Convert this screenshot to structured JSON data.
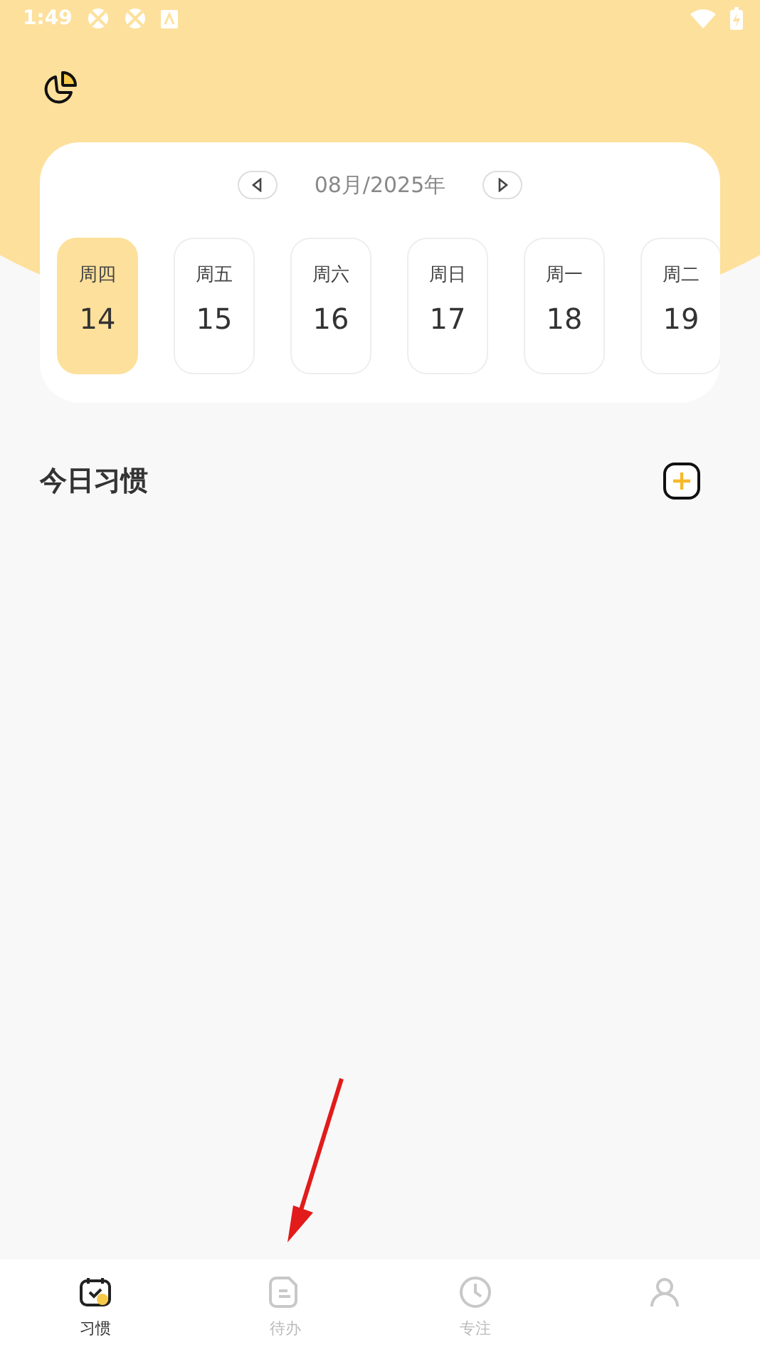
{
  "status_bar": {
    "time": "1:49"
  },
  "calendar": {
    "month": "08月/2025年",
    "days": [
      {
        "weekday": "周四",
        "date": "14",
        "selected": true
      },
      {
        "weekday": "周五",
        "date": "15",
        "selected": false
      },
      {
        "weekday": "周六",
        "date": "16",
        "selected": false
      },
      {
        "weekday": "周日",
        "date": "17",
        "selected": false
      },
      {
        "weekday": "周一",
        "date": "18",
        "selected": false
      },
      {
        "weekday": "周二",
        "date": "19",
        "selected": false
      }
    ]
  },
  "section": {
    "title": "今日习惯"
  },
  "nav": [
    {
      "kind": "habit",
      "label": "习惯",
      "selected": true
    },
    {
      "kind": "todo",
      "label": "待办",
      "selected": false
    },
    {
      "kind": "focus",
      "label": "专注",
      "selected": false
    },
    {
      "kind": "profile",
      "selected": false
    }
  ]
}
